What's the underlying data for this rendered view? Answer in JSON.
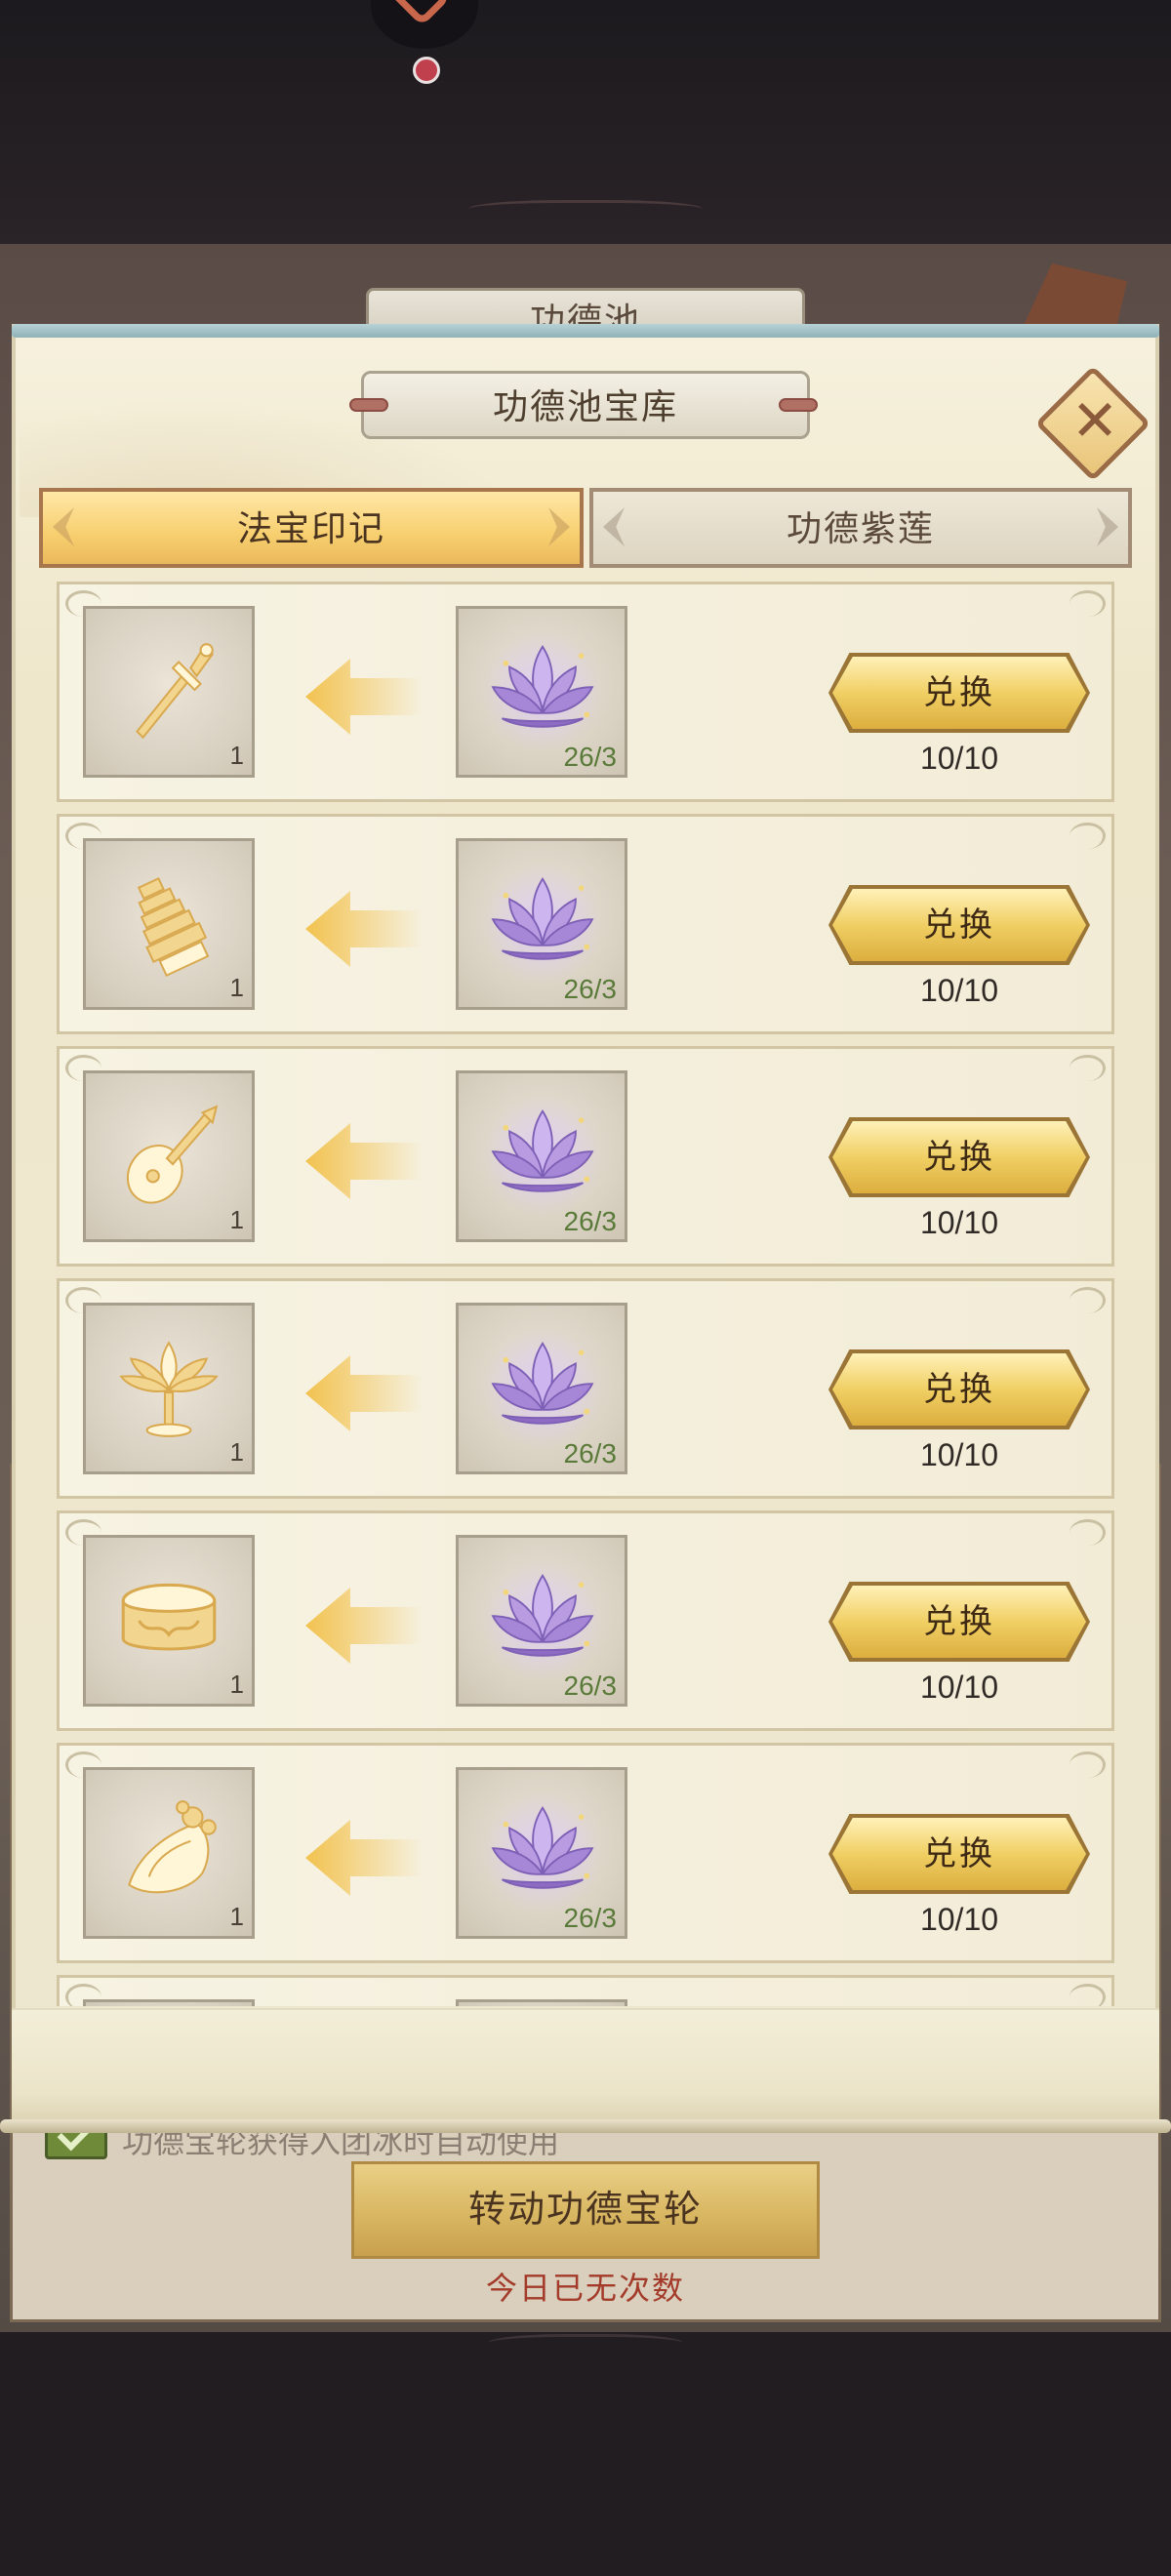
{
  "background": {
    "window_title": "功德池",
    "auto_use_label": "功德宝轮获得入团冰时自动使用",
    "spin_button_label": "转动功德宝轮",
    "spin_status": "今日已无次数"
  },
  "dialog": {
    "title": "功德池宝库",
    "tabs": [
      {
        "label": "法宝印记",
        "active": true
      },
      {
        "label": "功德紫莲",
        "active": false
      }
    ],
    "items": [
      {
        "icon": "sword-icon",
        "reward_qty": "1",
        "cost_icon": "purple-lotus-icon",
        "cost_qty": "26/3",
        "button": "兑换",
        "limit": "10/10"
      },
      {
        "icon": "pagoda-icon",
        "reward_qty": "1",
        "cost_icon": "purple-lotus-icon",
        "cost_qty": "26/3",
        "button": "兑换",
        "limit": "10/10"
      },
      {
        "icon": "pipa-icon",
        "reward_qty": "1",
        "cost_icon": "purple-lotus-icon",
        "cost_qty": "26/3",
        "button": "兑换",
        "limit": "10/10"
      },
      {
        "icon": "lotus-lamp-icon",
        "reward_qty": "1",
        "cost_icon": "purple-lotus-icon",
        "cost_qty": "26/3",
        "button": "兑换",
        "limit": "10/10"
      },
      {
        "icon": "bracelet-icon",
        "reward_qty": "1",
        "cost_icon": "purple-lotus-icon",
        "cost_qty": "26/3",
        "button": "兑换",
        "limit": "10/10"
      },
      {
        "icon": "conch-icon",
        "reward_qty": "1",
        "cost_icon": "purple-lotus-icon",
        "cost_qty": "26/3",
        "button": "兑换",
        "limit": "10/10"
      }
    ]
  },
  "colors": {
    "accent_gold": "#f0cf64",
    "lotus_purple": "#b89be0",
    "cost_green": "#5a7a3a",
    "status_red": "#a33a2a"
  }
}
